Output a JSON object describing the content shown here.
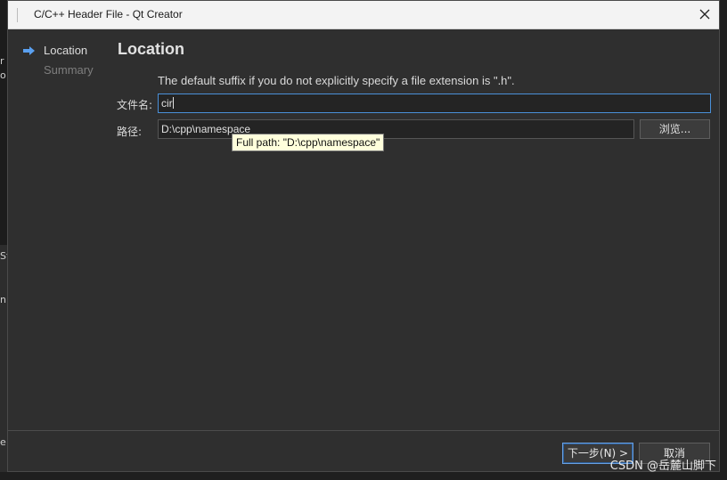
{
  "window": {
    "title": "C/C++ Header File - Qt Creator",
    "close_glyph": "close-icon"
  },
  "background": {
    "letters": [
      "r",
      "o",
      "St",
      "n",
      "e"
    ]
  },
  "steps": [
    {
      "label": "Location",
      "state": "current"
    },
    {
      "label": "Summary",
      "state": "pending"
    }
  ],
  "page": {
    "title": "Location",
    "hint": "The default suffix if you do not explicitly specify a file extension is \".h\"."
  },
  "form": {
    "filename_label": "文件名:",
    "filename_value": "cir",
    "path_label": "路径:",
    "path_value": "D:\\cpp\\namespace",
    "browse_label": "浏览..."
  },
  "tooltip": {
    "text": "Full path: \"D:\\cpp\\namespace\""
  },
  "buttons": {
    "next_label": "下一步(N) >",
    "cancel_label": "取消"
  },
  "watermark": "CSDN @岳麓山脚下",
  "colors": {
    "accent": "#4a90d9",
    "dialog_bg": "#2f2f2f",
    "tooltip_bg": "#ffffdc"
  }
}
